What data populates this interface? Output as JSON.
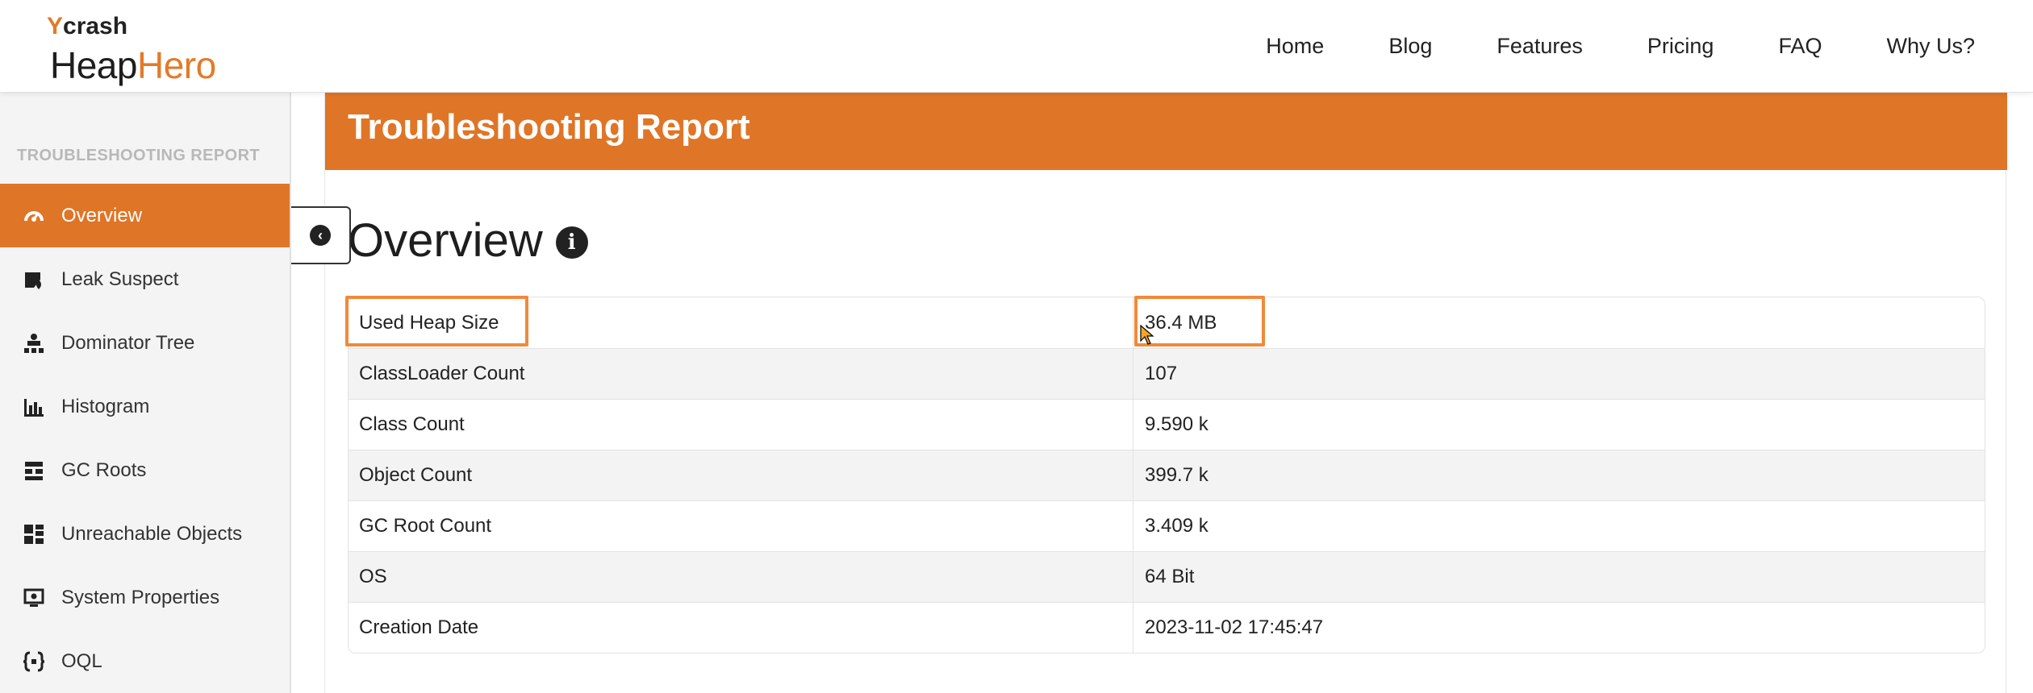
{
  "header": {
    "logo_small_prefix": "Y",
    "logo_small_text": "crash",
    "logo_heap": "Heap",
    "logo_hero": "Hero",
    "nav": [
      "Home",
      "Blog",
      "Features",
      "Pricing",
      "FAQ",
      "Why Us?"
    ]
  },
  "sidebar": {
    "section_title": "TROUBLESHOOTING REPORT",
    "items": [
      {
        "label": "Overview",
        "icon": "dashboard-icon",
        "active": true
      },
      {
        "label": "Leak Suspect",
        "icon": "leak-suspect-icon",
        "active": false
      },
      {
        "label": "Dominator Tree",
        "icon": "dominator-tree-icon",
        "active": false
      },
      {
        "label": "Histogram",
        "icon": "histogram-icon",
        "active": false
      },
      {
        "label": "GC Roots",
        "icon": "gc-roots-icon",
        "active": false
      },
      {
        "label": "Unreachable Objects",
        "icon": "unreachable-objects-icon",
        "active": false
      },
      {
        "label": "System Properties",
        "icon": "system-properties-icon",
        "active": false
      },
      {
        "label": "OQL",
        "icon": "oql-icon",
        "active": false
      }
    ]
  },
  "main": {
    "banner_title": "Troubleshooting Report",
    "section_heading": "Overview",
    "rows": [
      {
        "key": "Used Heap Size",
        "value": "36.4 MB"
      },
      {
        "key": "ClassLoader Count",
        "value": "107"
      },
      {
        "key": "Class Count",
        "value": "9.590 k"
      },
      {
        "key": "Object Count",
        "value": "399.7 k"
      },
      {
        "key": "GC Root Count",
        "value": "3.409 k"
      },
      {
        "key": "OS",
        "value": "64 Bit"
      },
      {
        "key": "Creation Date",
        "value": "2023-11-02 17:45:47"
      }
    ]
  },
  "colors": {
    "accent": "#df7526",
    "highlight": "#f08a3a"
  }
}
